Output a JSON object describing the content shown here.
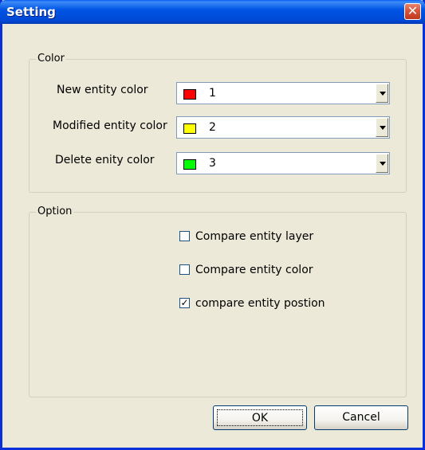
{
  "window": {
    "title": "Setting"
  },
  "color_group": {
    "label": "Color",
    "rows": [
      {
        "label": "New entity color",
        "value": "1",
        "swatch": "#ff0000"
      },
      {
        "label": "Modified entity color",
        "value": "2",
        "swatch": "#ffff00"
      },
      {
        "label": "Delete enity color",
        "value": "3",
        "swatch": "#00ff00"
      }
    ]
  },
  "option_group": {
    "label": "Option",
    "checkboxes": [
      {
        "label": "Compare entity layer",
        "checked": false
      },
      {
        "label": "Compare entity color",
        "checked": false
      },
      {
        "label": "compare entity postion",
        "checked": true
      }
    ]
  },
  "buttons": {
    "ok_label": "OK",
    "cancel_label": "Cancel"
  },
  "icons": {
    "close": "close-icon",
    "dropdown": "chevron-down-icon",
    "check": "checkmark-icon"
  }
}
